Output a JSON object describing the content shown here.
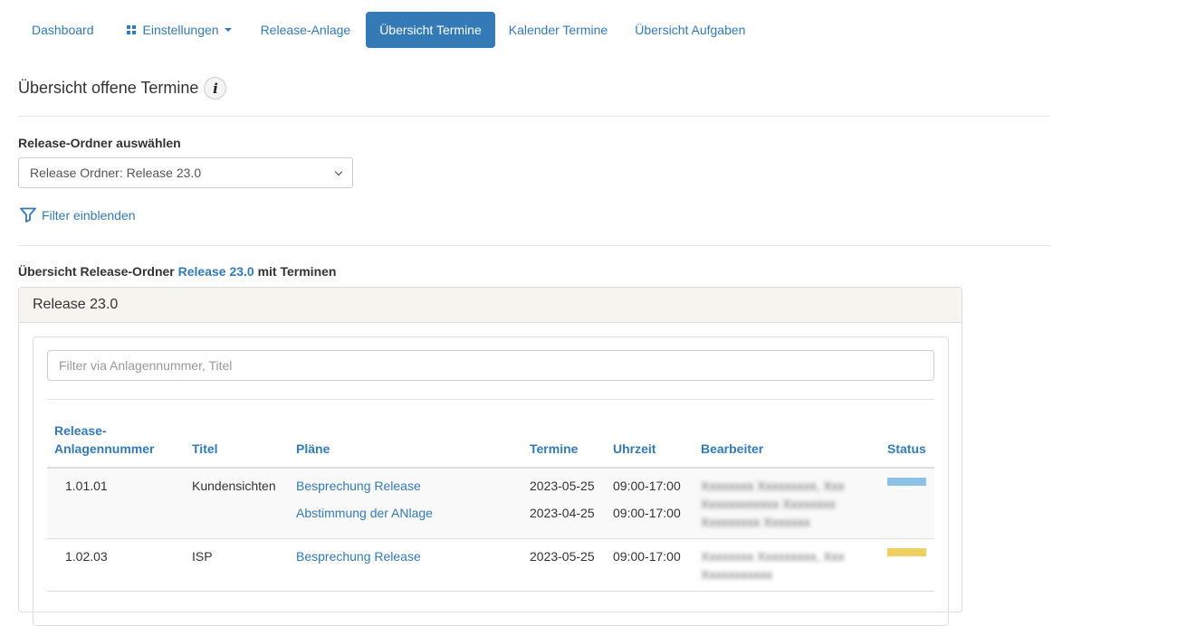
{
  "nav": {
    "items": [
      {
        "label": "Dashboard"
      },
      {
        "label": "Einstellungen"
      },
      {
        "label": "Release-Anlage"
      },
      {
        "label": "Übersicht Termine"
      },
      {
        "label": "Kalender Termine"
      },
      {
        "label": "Übersicht Aufgaben"
      }
    ],
    "active_index": 3
  },
  "page": {
    "title": "Übersicht offene Termine",
    "info_glyph": "i"
  },
  "release_select": {
    "label": "Release-Ordner auswählen",
    "value": "Release Ordner: Release 23.0"
  },
  "filter_toggle": {
    "label": "Filter einblenden"
  },
  "overview": {
    "prefix": "Übersicht Release-Ordner",
    "release": "Release 23.0",
    "suffix": "mit Terminen"
  },
  "panel": {
    "title": "Release 23.0",
    "search_placeholder": "Filter via Anlagennummer, Titel"
  },
  "table": {
    "headers": {
      "nummer_line1": "Release-",
      "nummer_line2": "Anlagennummer",
      "titel": "Titel",
      "plaene": "Pläne",
      "termine": "Termine",
      "uhrzeit": "Uhrzeit",
      "bearbeiter": "Bearbeiter",
      "status": "Status"
    },
    "rows": [
      {
        "nummer": "1.01.01",
        "titel": "Kundensichten",
        "plans": [
          {
            "name": "Besprechung Release",
            "termin": "2023-05-25",
            "uhrzeit": "09:00-17:00"
          },
          {
            "name": "Abstimmung der ANlage",
            "termin": "2023-04-25",
            "uhrzeit": "09:00-17:00"
          }
        ],
        "bearbeiter_lines": [
          "Xxxxxxxx Xxxxxxxxx, Xxx",
          "Xxxxxxxxxxxx Xxxxxxxx",
          "Xxxxxxxxx Xxxxxxx"
        ],
        "status_color": "#8ec1e6"
      },
      {
        "nummer": "1.02.03",
        "titel": "ISP",
        "plans": [
          {
            "name": "Besprechung Release",
            "termin": "2023-05-25",
            "uhrzeit": "09:00-17:00"
          }
        ],
        "bearbeiter_lines": [
          "Xxxxxxxx Xxxxxxxxx, Xxx",
          "Xxxxxxxxxxx"
        ],
        "status_color": "#f0d060"
      }
    ]
  },
  "colors": {
    "accent": "#337ab7",
    "panel_heading_bg": "#f5f4ee"
  }
}
